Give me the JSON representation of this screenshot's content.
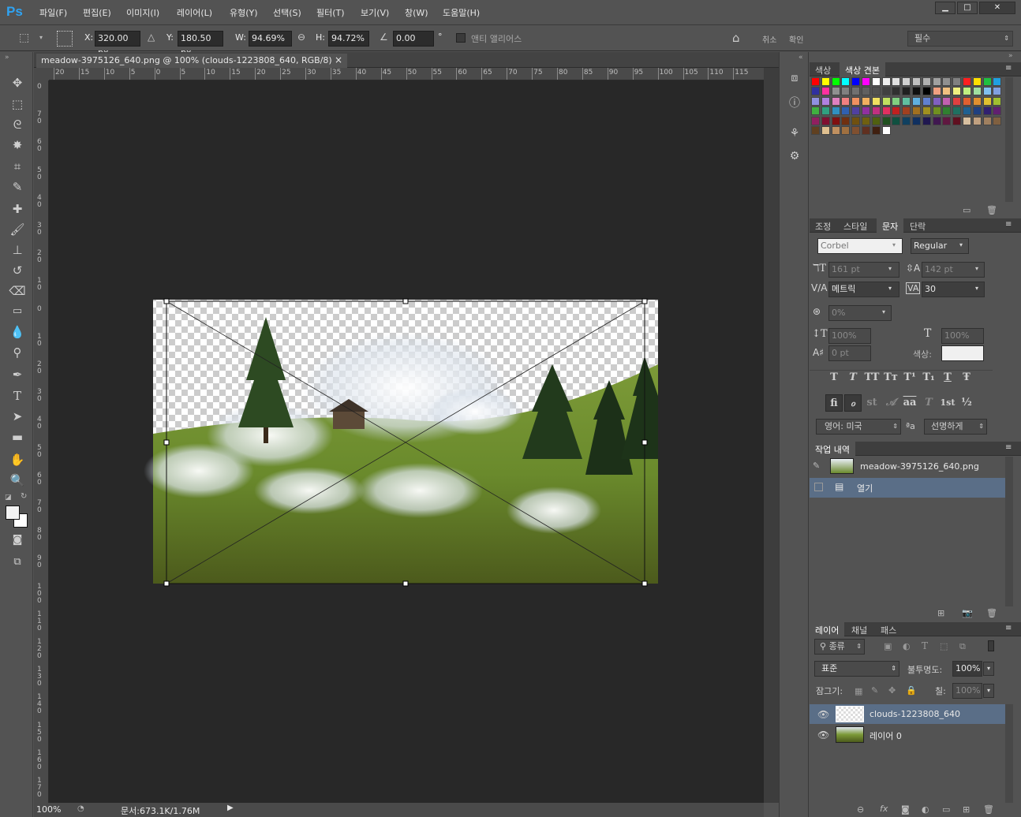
{
  "app": {
    "logo": "Ps"
  },
  "menu": [
    "파일(F)",
    "편집(E)",
    "이미지(I)",
    "레이어(L)",
    "유형(Y)",
    "선택(S)",
    "필터(T)",
    "보기(V)",
    "창(W)",
    "도움말(H)"
  ],
  "window_controls": {
    "minimize": "▁",
    "maximize": "□",
    "close": "✕"
  },
  "options": {
    "x_label": "X:",
    "x_value": "320.00 px",
    "y_label": "Y:",
    "y_value": "180.50 px",
    "w_label": "W:",
    "w_value": "94.69%",
    "h_label": "H:",
    "h_value": "94.72%",
    "angle_value": "0.00",
    "angle_unit": "°",
    "antialias_label": "앤티 앨리어스",
    "cancel_label": "취소",
    "commit_label": "확인",
    "workspace_value": "필수"
  },
  "document": {
    "tab_title": "meadow-3975126_640.png @ 100% (clouds-1223808_640, RGB/8)",
    "tab_close": "×",
    "zoom": "100%",
    "doc_info": "문서:673.1K/1.76M"
  },
  "rulers": {
    "h_ticks": [
      "20",
      "15",
      "10",
      "5",
      "0",
      "5",
      "10",
      "15",
      "20",
      "25",
      "30",
      "35",
      "40",
      "45",
      "50",
      "55",
      "60",
      "65",
      "70",
      "75",
      "80",
      "85",
      "90",
      "95",
      "100",
      "105",
      "110",
      "115"
    ],
    "v_ticks": [
      "0",
      "70",
      "60",
      "50",
      "40",
      "30",
      "20",
      "10",
      "0",
      "10",
      "20",
      "30",
      "40",
      "50",
      "60",
      "70",
      "80",
      "90",
      "100",
      "110",
      "120",
      "130",
      "140",
      "150",
      "160",
      "170"
    ]
  },
  "swatches_panel": {
    "tabs": [
      "색상",
      "색상 견본"
    ],
    "colors": [
      "#ff0000",
      "#ffff00",
      "#00ff00",
      "#00ffff",
      "#0000ff",
      "#ff00ff",
      "#ffffff",
      "#eeeeee",
      "#e0e0e0",
      "#d0d0d0",
      "#c0c0c0",
      "#b0b0b0",
      "#a0a0a0",
      "#909090",
      "#808080",
      "#ff2020",
      "#ffe000",
      "#20c040",
      "#20a0e0",
      "#3030a0",
      "#ff30a0",
      "#909090",
      "#808080",
      "#707070",
      "#606060",
      "#505050",
      "#404040",
      "#303030",
      "#202020",
      "#101010",
      "#000000",
      "#f0a080",
      "#f0c080",
      "#f0f080",
      "#c0f080",
      "#a0e0a0",
      "#80c0f0",
      "#80a0e0",
      "#9090e0",
      "#b080e0",
      "#e080c0",
      "#f08080",
      "#f09060",
      "#f0b060",
      "#f0e060",
      "#c0e060",
      "#80d080",
      "#60c0a0",
      "#60b0e0",
      "#6080d0",
      "#8060c0",
      "#c060b0",
      "#e04040",
      "#e06030",
      "#e09030",
      "#e0c030",
      "#a0c030",
      "#40b040",
      "#30a080",
      "#3090c0",
      "#3060b0",
      "#5040a0",
      "#9030a0",
      "#c03080",
      "#e03060",
      "#c02020",
      "#a04020",
      "#a07020",
      "#a09020",
      "#709020",
      "#308030",
      "#207060",
      "#206090",
      "#204080",
      "#302070",
      "#602070",
      "#902060",
      "#801030",
      "#801010",
      "#703010",
      "#705010",
      "#706010",
      "#506010",
      "#205020",
      "#105040",
      "#104060",
      "#103060",
      "#201850",
      "#401850",
      "#601840",
      "#601020",
      "#d8c0a0",
      "#c0a080",
      "#a08060",
      "#806040",
      "#604020",
      "#e0c090",
      "#c09060",
      "#a07040",
      "#805030",
      "#603020",
      "#402010",
      "#ffffff"
    ]
  },
  "character_panel": {
    "tabs": [
      "조정",
      "스타일",
      "문자",
      "단락"
    ],
    "font_family": "Corbel",
    "font_style": "Regular",
    "font_size": "161 pt",
    "leading": "142 pt",
    "kerning": "메트릭",
    "tracking": "30",
    "tsume": "0%",
    "v_scale": "100%",
    "h_scale": "100%",
    "baseline": "0 pt",
    "color_label": "색상:",
    "type_glyphs": [
      "T",
      "T",
      "TT",
      "Tт",
      "T¹",
      "T₁",
      "T",
      "Ŧ"
    ],
    "ot_glyphs": [
      "fi",
      "ℴ",
      "st",
      "𝒜",
      "aa",
      "T",
      "1st",
      "½"
    ],
    "language": "영어: 미국",
    "aa_icon": "ªa",
    "antialias": "선명하게"
  },
  "history_panel": {
    "tab": "작업 내역",
    "snapshot": "meadow-3975126_640.png",
    "items": [
      "열기"
    ]
  },
  "layers_panel": {
    "tabs": [
      "레이어",
      "채널",
      "패스"
    ],
    "filter_label": "종류",
    "blend_mode": "표준",
    "opacity_label": "불투명도:",
    "opacity": "100%",
    "lock_label": "잠그기:",
    "fill_label": "칠:",
    "fill": "100%",
    "layers": [
      {
        "name": "clouds-1223808_640",
        "selected": true
      },
      {
        "name": "레이어 0",
        "selected": false
      }
    ]
  },
  "colors": {
    "accent": "#2fa3f2",
    "selected_row": "#5a6e87"
  }
}
